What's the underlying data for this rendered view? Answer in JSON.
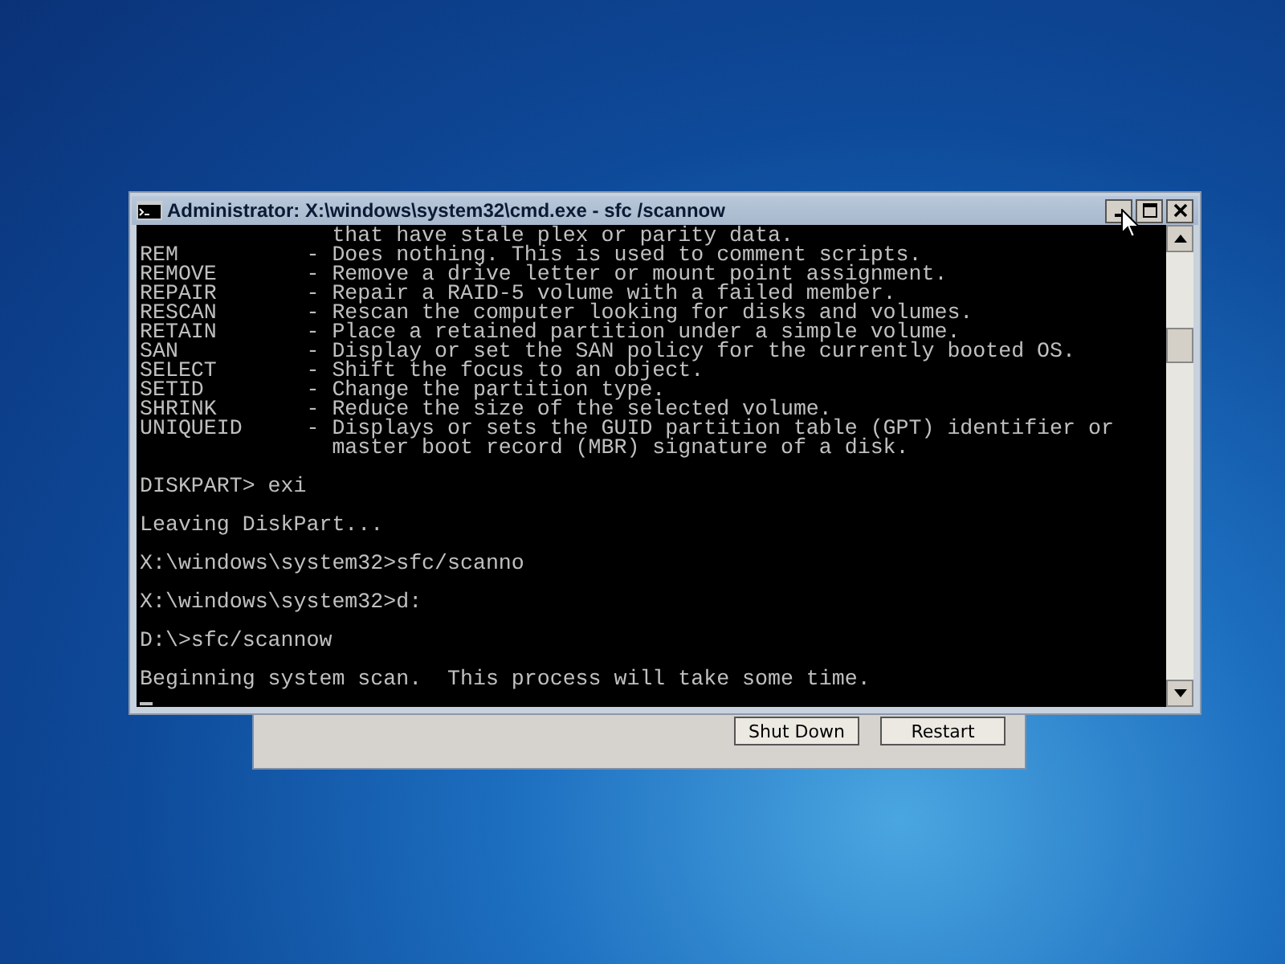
{
  "background_dialog": {
    "buttons": [
      "Shut Down",
      "Restart"
    ]
  },
  "window": {
    "title": "Administrator: X:\\windows\\system32\\cmd.exe - sfc /scannow"
  },
  "console": {
    "blocks": [
      [
        "               that have stale plex or parity data.",
        "REM          - Does nothing. This is used to comment scripts.",
        "REMOVE       - Remove a drive letter or mount point assignment.",
        "REPAIR       - Repair a RAID-5 volume with a failed member.",
        "RESCAN       - Rescan the computer looking for disks and volumes.",
        "RETAIN       - Place a retained partition under a simple volume.",
        "SAN          - Display or set the SAN policy for the currently booted OS.",
        "SELECT       - Shift the focus to an object.",
        "SETID        - Change the partition type.",
        "SHRINK       - Reduce the size of the selected volume.",
        "UNIQUEID     - Displays or sets the GUID partition table (GPT) identifier or",
        "               master boot record (MBR) signature of a disk."
      ],
      [
        "DISKPART> exi"
      ],
      [
        "Leaving DiskPart..."
      ],
      [
        "X:\\windows\\system32>sfc/scanno"
      ],
      [
        "X:\\windows\\system32>d:"
      ],
      [
        "D:\\>sfc/scannow"
      ],
      [
        "Beginning system scan.  This process will take some time."
      ]
    ]
  }
}
